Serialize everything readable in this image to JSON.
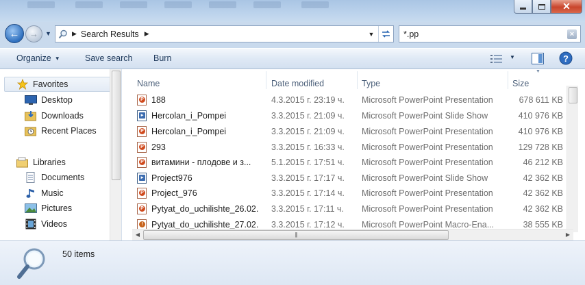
{
  "window": {
    "controls": {
      "minimize_icon": "minimize-icon",
      "maximize_icon": "maximize-icon",
      "close_icon": "close-icon"
    }
  },
  "navigation": {
    "breadcrumb": "Search Results",
    "search_value": "*.pp"
  },
  "toolbar": {
    "organize": "Organize",
    "save_search": "Save search",
    "burn": "Burn"
  },
  "sidebar": {
    "favorites": "Favorites",
    "desktop": "Desktop",
    "downloads": "Downloads",
    "recent_places": "Recent Places",
    "libraries": "Libraries",
    "documents": "Documents",
    "music": "Music",
    "pictures": "Pictures",
    "videos": "Videos"
  },
  "columns": {
    "name": "Name",
    "date": "Date modified",
    "type": "Type",
    "size": "Size"
  },
  "files": [
    {
      "name": "188",
      "date": "4.3.2015 г. 23:19 ч.",
      "type": "Microsoft PowerPoint Presentation",
      "size": "678 611 KB"
    },
    {
      "name": "Hercolan_i_Pompei",
      "date": "3.3.2015 г. 21:09 ч.",
      "type": "Microsoft PowerPoint Slide Show",
      "size": "410 976 KB"
    },
    {
      "name": "Hercolan_i_Pompei",
      "date": "3.3.2015 г. 21:09 ч.",
      "type": "Microsoft PowerPoint Presentation",
      "size": "410 976 KB"
    },
    {
      "name": "293",
      "date": "3.3.2015 г. 16:33 ч.",
      "type": "Microsoft PowerPoint Presentation",
      "size": "129 728 KB"
    },
    {
      "name": "витамини - плодове и з...",
      "date": "5.1.2015 г. 17:51 ч.",
      "type": "Microsoft PowerPoint Presentation",
      "size": "46 212 KB"
    },
    {
      "name": "Project976",
      "date": "3.3.2015 г. 17:17 ч.",
      "type": "Microsoft PowerPoint Slide Show",
      "size": "42 362 KB"
    },
    {
      "name": "Project_976",
      "date": "3.3.2015 г. 17:14 ч.",
      "type": "Microsoft PowerPoint Presentation",
      "size": "42 362 KB"
    },
    {
      "name": "Pytyat_do_uchilishte_26.02.",
      "date": "3.3.2015 г. 17:11 ч.",
      "type": "Microsoft PowerPoint Presentation",
      "size": "42 362 KB"
    },
    {
      "name": "Pytyat_do_uchilishte_27.02.",
      "date": "3.3.2015 г. 17:12 ч.",
      "type": "Microsoft PowerPoint Macro-Ena...",
      "size": "38 555 KB"
    }
  ],
  "status": {
    "count": "50 items"
  },
  "colors": {
    "window_frame": "#c9daed",
    "accent": "#2e6fbe",
    "ppt_icon": "#d04a1d"
  }
}
